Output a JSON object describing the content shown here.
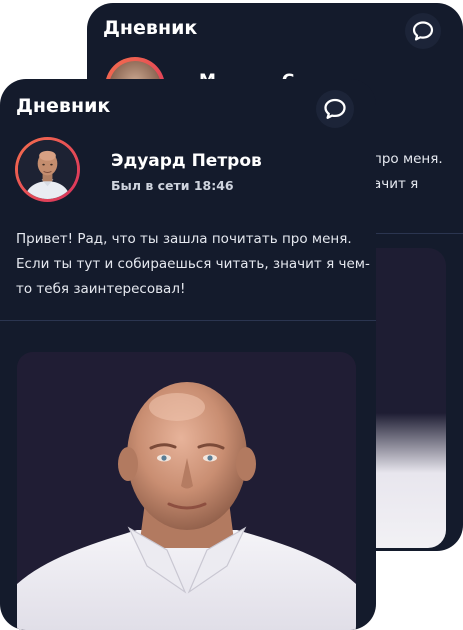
{
  "back_card": {
    "title": "Дневник",
    "name_fragment": "М",
    "name_fragment_2": "С",
    "text_line_1": "про меня.",
    "text_line_2": "ачит я",
    "icons": {
      "chat": "chat-bubble-icon"
    }
  },
  "front_card": {
    "title": "Дневник",
    "user": {
      "name": "Эдуард Петров",
      "status": "Был в сети 18:46"
    },
    "bio": "Привет! Рад, что ты зашла почитать про меня. Если ты тут и собираешься читать, значит я чем-то тебя заинтересовал!",
    "icons": {
      "chat": "chat-bubble-icon",
      "avatar": "avatar-photo"
    }
  },
  "colors": {
    "card_bg": "#141b2c",
    "accent_gradient_start": "#f5704d",
    "accent_gradient_end": "#d9305d",
    "text": "#ffffff"
  }
}
